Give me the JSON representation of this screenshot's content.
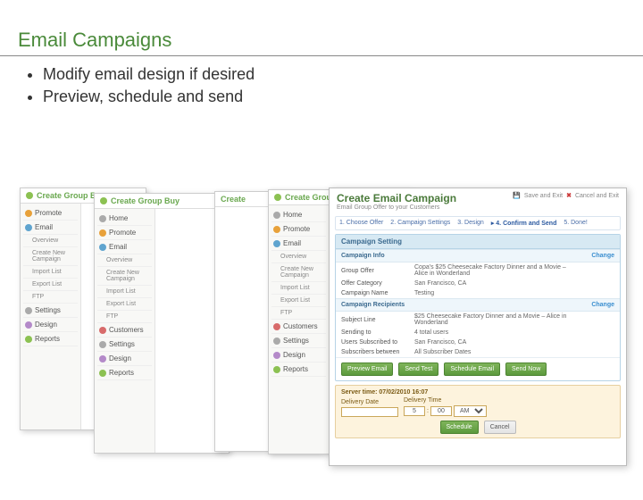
{
  "slide": {
    "title": "Email Campaigns",
    "bullets": [
      "Modify email design if desired",
      "Preview, schedule and send"
    ]
  },
  "sidebar": {
    "create_group_buy": "Create Group Buy",
    "items": [
      {
        "label": "Home"
      },
      {
        "label": "Promote"
      },
      {
        "label": "Email"
      },
      {
        "label": "Overview"
      },
      {
        "label": "Create New Campaign"
      },
      {
        "label": "Import List"
      },
      {
        "label": "Export List"
      },
      {
        "label": "FTP"
      },
      {
        "label": "Customers"
      },
      {
        "label": "Settings"
      },
      {
        "label": "Design"
      },
      {
        "label": "Reports"
      }
    ]
  },
  "front": {
    "title": "Create Email Campaign",
    "subtitle": "Email Group Offer to your Customers",
    "save_exit": "Save and Exit",
    "cancel_exit": "Cancel and Exit",
    "steps": [
      {
        "label": "1. Choose Offer"
      },
      {
        "label": "2. Campaign Settings"
      },
      {
        "label": "3. Design"
      },
      {
        "label": "4. Confirm and Send",
        "active": true
      },
      {
        "label": "5. Done!"
      }
    ],
    "panel_title": "Campaign Setting",
    "section1_title": "Campaign Info",
    "rows1": [
      {
        "k": "Group Offer",
        "v": "Copa's $25 Cheesecake Factory Dinner and a Movie – Alice in Wonderland"
      },
      {
        "k": "Offer Category",
        "v": "San Francisco, CA"
      },
      {
        "k": "Campaign Name",
        "v": "Testing"
      }
    ],
    "section2_title": "Campaign Recipients",
    "rows2": [
      {
        "k": "Subject Line",
        "v": "$25 Cheesecake Factory Dinner and a Movie – Alice in Wonderland"
      },
      {
        "k": "Sending to",
        "v": "4 total users"
      },
      {
        "k": "Users Subscribed to",
        "v": "San Francisco, CA"
      },
      {
        "k": "Subscribers between",
        "v": "All Subscriber Dates"
      }
    ],
    "change": "Change",
    "buttons": {
      "preview": "Preview Email",
      "sendtest": "Send Test",
      "schedule": "Schedule Email",
      "sendnow": "Send Now"
    },
    "delivery": {
      "server": "Server time: 07/02/2010 16:07",
      "date_label": "Delivery Date",
      "time_label": "Delivery Time",
      "date": "",
      "hh": "5",
      "mm": "00",
      "ampm": "AM",
      "schedule_btn": "Schedule",
      "cancel_btn": "Cancel"
    }
  }
}
